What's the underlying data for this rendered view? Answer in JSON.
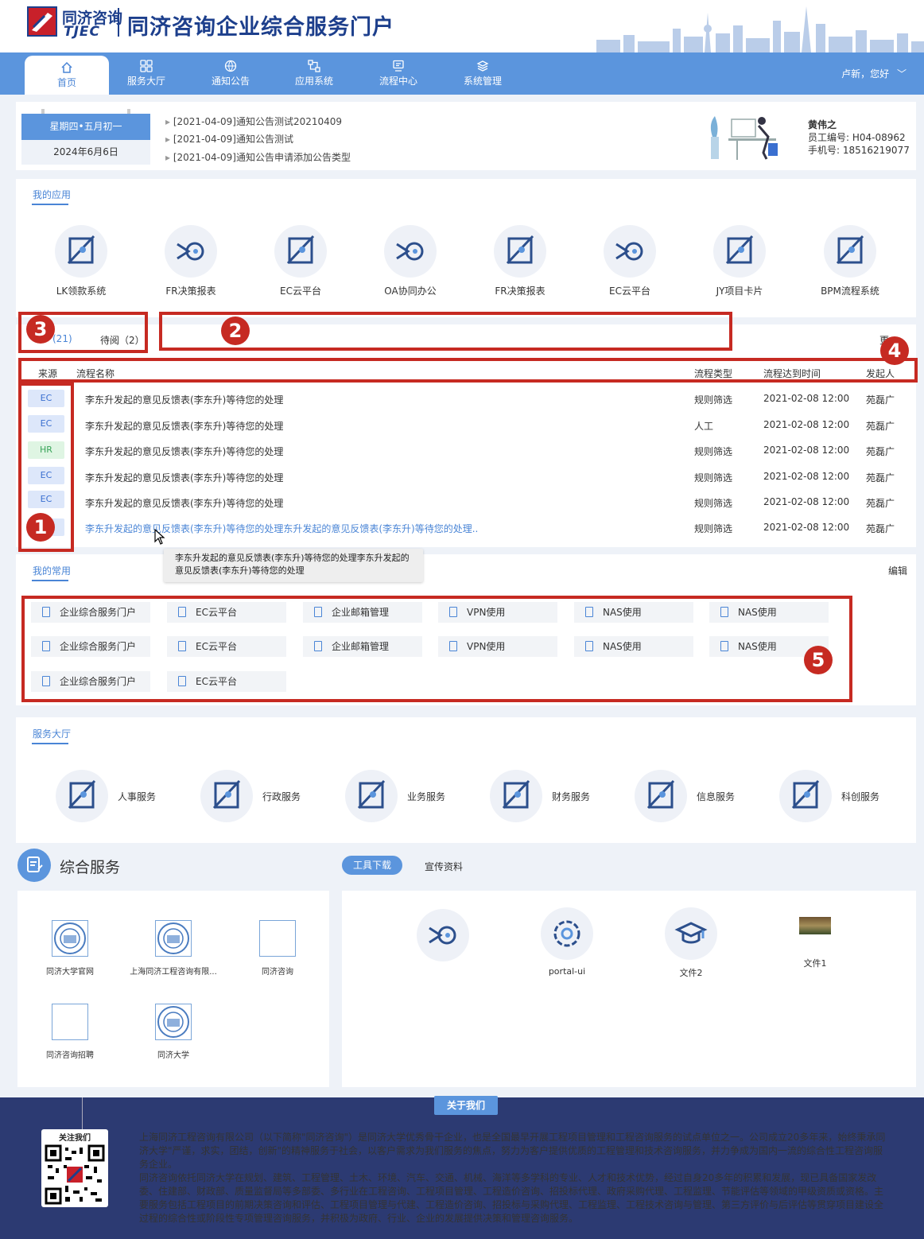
{
  "header": {
    "logo_cn": "同济咨询",
    "logo_en": "TJEC",
    "title": "同济咨询企业综合服务门户"
  },
  "nav": {
    "items": [
      "首页",
      "服务大厅",
      "通知公告",
      "应用系统",
      "流程中心",
      "系统管理"
    ],
    "user": "卢新，您好"
  },
  "calendar": {
    "lunar": "星期四•五月初一",
    "date": "2024年6月6日"
  },
  "notices": [
    "[2021-04-09]通知公告测试20210409",
    "[2021-04-09]通知公告测试",
    "[2021-04-09]通知公告申请添加公告类型"
  ],
  "user": {
    "name": "黄伟之",
    "emp_no": "员工编号: H04-08962",
    "phone": "手机号: 18516219077"
  },
  "apps": {
    "title": "我的应用",
    "items": [
      "LK领款系统",
      "FR决策报表",
      "EC云平台",
      "OA协同办公",
      "FR决策报表",
      "EC云平台",
      "JY项目卡片",
      "BPM流程系统"
    ]
  },
  "process": {
    "tab_todo": "(21)",
    "tab_read": "待阅（2）",
    "more": "更",
    "headers": [
      "来源",
      "流程名称",
      "流程类型",
      "流程达到时间",
      "发起人"
    ],
    "rows": [
      {
        "src": "EC",
        "name": "李东升发起的意见反馈表(李东升)等待您的处理",
        "type": "规则筛选",
        "time": "2021-02-08 12:00",
        "by": "苑磊广"
      },
      {
        "src": "EC",
        "name": "李东升发起的意见反馈表(李东升)等待您的处理",
        "type": "人工",
        "time": "2021-02-08 12:00",
        "by": "苑磊广"
      },
      {
        "src": "HR",
        "name": "李东升发起的意见反馈表(李东升)等待您的处理",
        "type": "规则筛选",
        "time": "2021-02-08 12:00",
        "by": "苑磊广"
      },
      {
        "src": "EC",
        "name": "李东升发起的意见反馈表(李东升)等待您的处理",
        "type": "规则筛选",
        "time": "2021-02-08 12:00",
        "by": "苑磊广"
      },
      {
        "src": "EC",
        "name": "李东升发起的意见反馈表(李东升)等待您的处理",
        "type": "规则筛选",
        "time": "2021-02-08 12:00",
        "by": "苑磊广"
      },
      {
        "src": "",
        "name": "李东升发起的意见反馈表(李东升)等待您的处理东升发起的意见反馈表(李东升)等待您的处理..",
        "type": "规则筛选",
        "time": "2021-02-08 12:00",
        "by": "苑磊广"
      }
    ],
    "tooltip": "李东升发起的意见反馈表(李东升)等待您的处理李东升发起的意见反馈表(李东升)等待您的处理"
  },
  "favorites": {
    "title": "我的常用",
    "edit": "编辑",
    "items": [
      "企业综合服务门户",
      "EC云平台",
      "企业邮箱管理",
      "VPN使用",
      "NAS使用",
      "NAS使用",
      "企业综合服务门户",
      "EC云平台",
      "企业邮箱管理",
      "VPN使用",
      "NAS使用",
      "NAS使用",
      "企业综合服务门户",
      "EC云平台"
    ]
  },
  "services": {
    "title": "服务大厅",
    "items": [
      "人事服务",
      "行政服务",
      "业务服务",
      "财务服务",
      "信息服务",
      "科创服务"
    ]
  },
  "integrated": {
    "title": "综合服务",
    "tab_tools": "工具下载",
    "tab_promo": "宣传资料",
    "links": [
      "同济大学官网",
      "上海同济工程咨询有限...",
      "同济咨询",
      "同济咨询招聘",
      "同济大学"
    ],
    "tools": [
      "",
      "portal-ui",
      "文件2",
      "文件1"
    ]
  },
  "footer": {
    "about": "关于我们",
    "follow": "关注我们",
    "p1": "上海同济工程咨询有限公司（以下简称\"同济咨询\"）是同济大学优秀骨干企业，也是全国最早开展工程项目管理和工程咨询服务的试点单位之一。公司成立20多年来，始终秉承同济大学\"严谨，求实，团结，创新\"的精神服务于社会，以客户需求为我们服务的焦点，努力为客户提供优质的工程管理和技术咨询服务，并力争成为国内一流的综合性工程咨询服务企业。",
    "p2": "同济咨询依托同济大学在规划、建筑、工程管理、土木、环境、汽车、交通、机械、海洋等多学科的专业、人才和技术优势，经过自身20多年的积累和发展，现已具备国家发改委、住建部、财政部、质量监督局等多部委、多行业在工程咨询、工程项目管理、工程造价咨询、招投标代理、政府采购代理、工程监理、节能评估等领域的甲级资质或资格。主要服务包括工程项目的前期决策咨询和评估、工程项目管理与代建、工程造价咨询、招投标与采购代理、工程监理、工程技术咨询与管理、第三方评价与后评估等贯穿项目建设全过程的综合性或阶段性专项管理咨询服务，并积极为政府、行业、企业的发展提供决策和管理咨询服务。"
  },
  "markers": [
    "1",
    "2",
    "3",
    "4",
    "5"
  ],
  "colors": {
    "primary": "#5b95dd",
    "brand": "#1d3f8c",
    "annotation": "#c62a22",
    "footer": "#2c3a72"
  }
}
